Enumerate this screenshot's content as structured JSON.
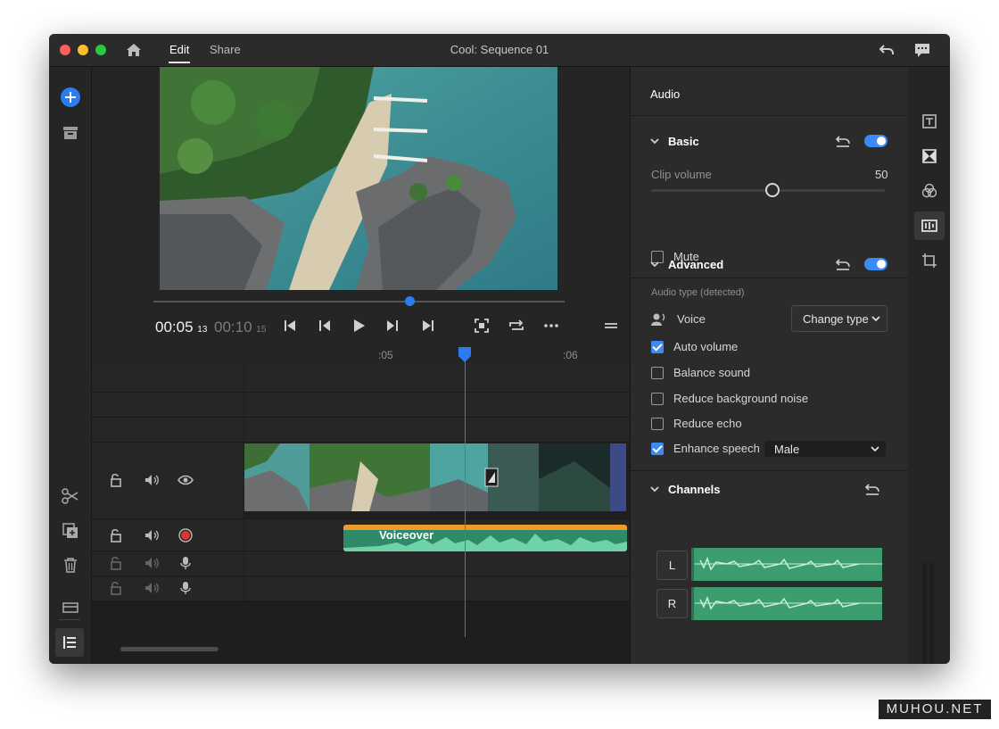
{
  "window": {
    "title": "Cool: Sequence 01"
  },
  "tabs": [
    {
      "label": "Edit"
    },
    {
      "label": "Share"
    }
  ],
  "playback": {
    "current": "00:05",
    "current_frames": "13",
    "duration": "00:10",
    "duration_frames": "15",
    "scrub_progress": 0.52
  },
  "timeline": {
    "ruler_labels": [
      ":05",
      ":06"
    ],
    "audio_clip_label": "Voiceover"
  },
  "panel": {
    "title": "Audio",
    "basic": {
      "title": "Basic",
      "enabled": true,
      "clip_volume_label": "Clip volume",
      "clip_volume_value": "50",
      "mute_label": "Mute",
      "mute_checked": false
    },
    "advanced": {
      "title": "Advanced",
      "enabled": true,
      "audio_type_label": "Audio type (detected)",
      "voice_label": "Voice",
      "change_type_label": "Change type",
      "options": [
        {
          "label": "Auto volume",
          "checked": true
        },
        {
          "label": "Balance sound",
          "checked": false
        },
        {
          "label": "Reduce background noise",
          "checked": false
        },
        {
          "label": "Reduce echo",
          "checked": false
        },
        {
          "label": "Enhance speech",
          "checked": true
        }
      ],
      "enhance_speech_value": "Male"
    },
    "channels": {
      "title": "Channels",
      "left": "L",
      "right": "R"
    }
  },
  "colors": {
    "accent": "#3a8bf5",
    "audio_clip": "#ef9a2a",
    "waveform": "#3c9d6e",
    "record": "#e0342f"
  },
  "watermark": "MUHOU.NET"
}
